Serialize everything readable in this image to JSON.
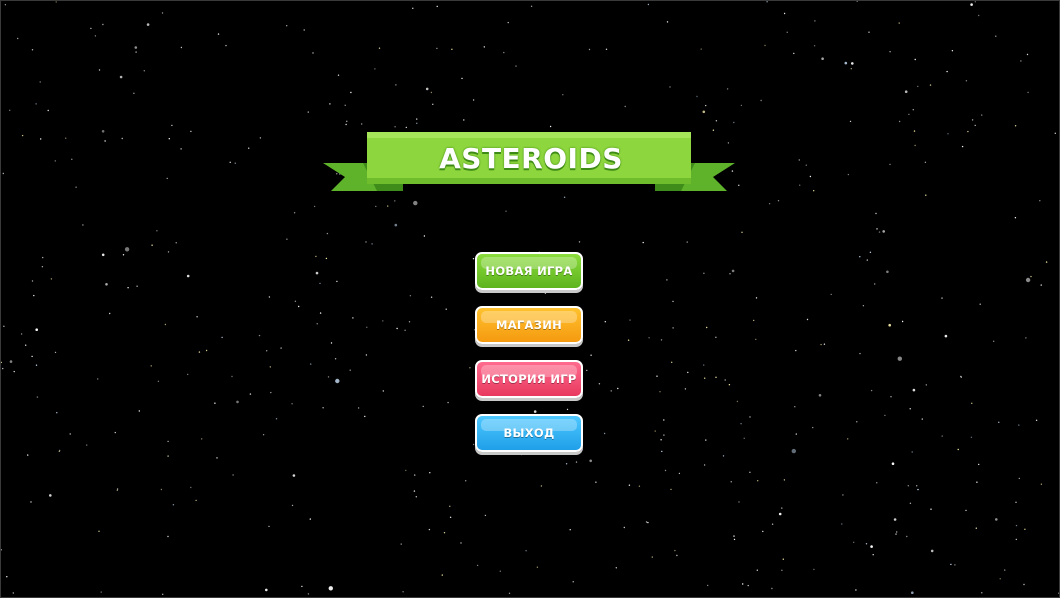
{
  "game": {
    "title": "ASTEROIDS",
    "title_ribbon_color": "#8ed63e",
    "background_color": "#000000"
  },
  "menu": {
    "items": [
      {
        "label": "НОВАЯ ИГРА",
        "color": "#6cc72a"
      },
      {
        "label": "МАГАЗИН",
        "color": "#f7a91a"
      },
      {
        "label": "ИСТОРИЯ ИГР",
        "color": "#f04a6e"
      },
      {
        "label": "ВЫХОД",
        "color": "#2db2f5"
      }
    ]
  }
}
